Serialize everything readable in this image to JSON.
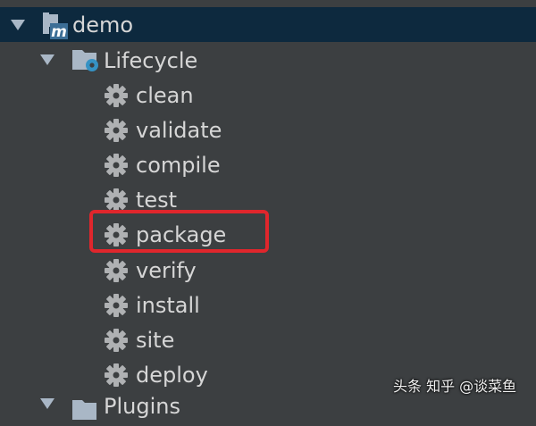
{
  "project": {
    "name": "demo",
    "icon": "maven-module-icon"
  },
  "lifecycle": {
    "label": "Lifecycle",
    "icon": "lifecycle-folder-icon",
    "phases": [
      "clean",
      "validate",
      "compile",
      "test",
      "package",
      "verify",
      "install",
      "site",
      "deploy"
    ]
  },
  "plugins": {
    "label": "Plugins"
  },
  "watermark": {
    "text": "头条 知乎 @谈菜鱼"
  },
  "colors": {
    "background": "#3c3f41",
    "selection": "#0d293e",
    "highlight_box": "#e0262c",
    "gear": "#afb1b3",
    "folder": "#a9b7c6",
    "folder_gear": "#3592c4"
  }
}
